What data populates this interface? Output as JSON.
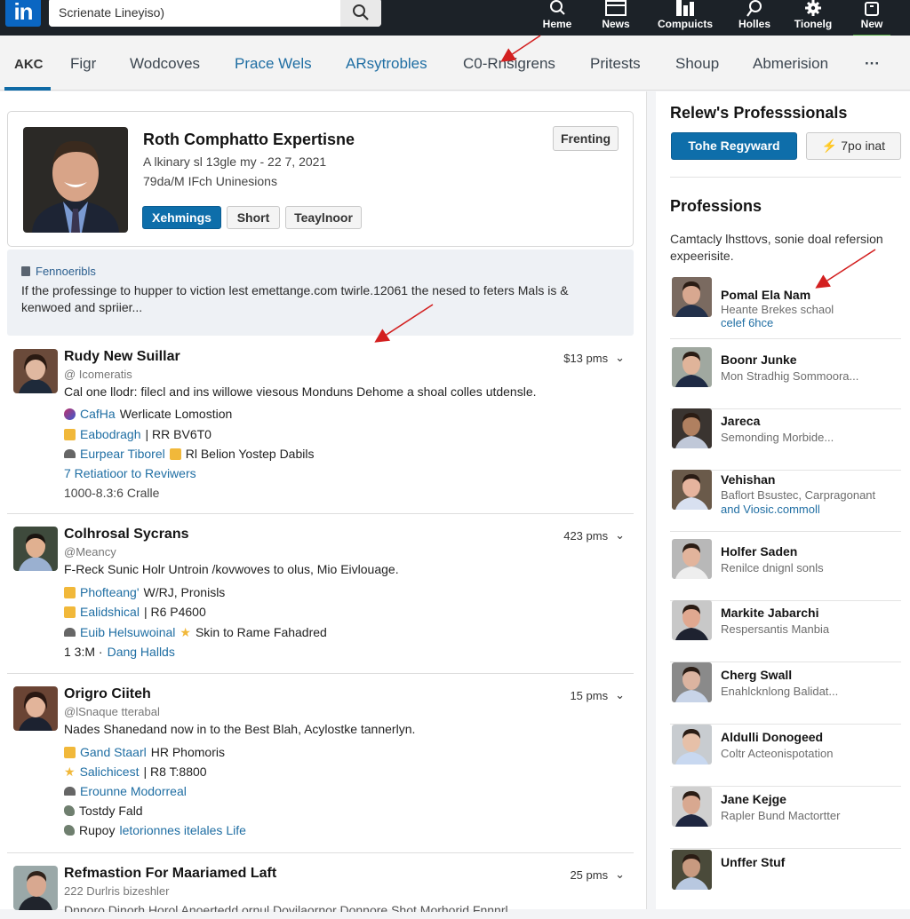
{
  "topbar": {
    "logo": "in",
    "search": {
      "value": "Scrienate Lineyiso)",
      "placeholder": "Search"
    },
    "nav": [
      {
        "label": "Heme",
        "icon": "search-icon"
      },
      {
        "label": "News",
        "icon": "news-icon"
      },
      {
        "label": "Compuicts",
        "icon": "chart-icon"
      },
      {
        "label": "Holles",
        "icon": "magnifier-icon"
      },
      {
        "label": "Tionelg",
        "icon": "gear-icon"
      },
      {
        "label": "New",
        "icon": "bag-icon",
        "active": true
      }
    ]
  },
  "tabs": [
    {
      "label": "AKC",
      "active": true
    },
    {
      "label": "Figr"
    },
    {
      "label": "Wodcoves"
    },
    {
      "label": "Prace Wels",
      "highlight": true
    },
    {
      "label": "ARsytrobles",
      "highlight": true
    },
    {
      "label": "C0-Rnsigrens"
    },
    {
      "label": "Pritests"
    },
    {
      "label": "Shoup"
    },
    {
      "label": "Abmerision"
    },
    {
      "label": "···"
    }
  ],
  "profile": {
    "name": "Roth Comphatto Expertisne",
    "line1": "A lkinary sl 13gle my - 22 7, 2021",
    "line2": "79da/M IFch Uninesions",
    "action_button": "Frenting",
    "buttons": [
      "Xehmings",
      "Short",
      "Teaylnoor"
    ]
  },
  "notice": {
    "title": "Fennoeribls",
    "text": "If the professinge to hupper to viction lest emettange.com twirle.12061 the nesed to feters Mals is & kenwoed and spriier..."
  },
  "posts": [
    {
      "name": "Rudy New Suillar",
      "handle": "@ Icomeratis",
      "meta": "$13 pms",
      "body": "Cal one llodr: filecl and ins willowe viesous Monduns Dehome a shoal colles utdensle.",
      "lines": [
        {
          "icon": "badge-icon",
          "link": "CafHa",
          "text": "Werlicate Lomostion"
        },
        {
          "icon": "gold-icon",
          "link": "Eabodragh",
          "text": "| RR BV6T0"
        },
        {
          "icon": "hat-icon",
          "link": "Eurpear Tiborel",
          "icon2": "gold-icon",
          "text": "Rl Belion Yostep Dabils"
        },
        {
          "link": "7 Retiatioor to Reviwers",
          "text": ""
        },
        {
          "text": "1000-8.3:6 Cralle"
        }
      ]
    },
    {
      "name": "Colhrosal Sycrans",
      "handle": "@Meancy",
      "meta": "423 pms",
      "body": "F-Reck Sunic Holr Untroin /kovwoves to olus, Mio Eivlouage.",
      "lines": [
        {
          "icon": "gold-icon",
          "link": "Phofteang'",
          "text": "W/RJ, Pronisls"
        },
        {
          "icon": "gold-icon",
          "link": "Ealidshical",
          "text": "| R6 P4600"
        },
        {
          "icon": "hat-icon",
          "link": "Euib Helsuwoinal",
          "icon2": "star-icon",
          "text": "Skin to Rame Fahadred"
        },
        {
          "text": "1 3:M ·",
          "link_after": "Dang Hallds"
        }
      ]
    },
    {
      "name": "Origro Ciiteh",
      "handle": "@lSnaque tterabal",
      "meta": "15 pms",
      "body": "Nades Shanedand now in to the Best Blah, Acylostke tannerlyn.",
      "lines": [
        {
          "icon": "gold-icon",
          "link": "Gand Staarl",
          "text": "HR Phomoris"
        },
        {
          "icon": "star-icon",
          "link": "Salichicest",
          "text": "| R8 T:8800"
        },
        {
          "icon": "hat-icon",
          "link": "Erounne Modorreal",
          "text": ""
        },
        {
          "icon": "hand-icon",
          "text": "Tostdy Fald"
        },
        {
          "icon": "hand-icon",
          "text": "Rupoy",
          "link_after": "letorionnes itelales Life"
        }
      ]
    },
    {
      "name": "Refmastion For Maariamed Laft",
      "handle": "222 Durlris bizeshler",
      "meta": "25 pms",
      "body": "Dnnoro Dinorh Horol Anoertedd ornul Dovilaornor Donnore Shot Morhorid Fnnnrl"
    }
  ],
  "sidebar": {
    "title": "Relew's Professsionals",
    "primary_button": "Tohe Regyward",
    "secondary_button": "⚡ 7po inat",
    "section_title": "Professions",
    "description": "Camtacly lhsttovs, sonie doal refersion expeerisite.",
    "people": [
      {
        "name": "Pomal Ela Nam",
        "title": "Heante Brekes schaol",
        "link": "celef 6hce"
      },
      {
        "name": "Boonr Junke",
        "title": "Mon Stradhig Sommoora..."
      },
      {
        "name": "Jareca",
        "title": "Semonding Morbide..."
      },
      {
        "name": "Vehishan",
        "title": "Baflort Bsustec, Carpragonant",
        "link": "and Viosic.commoll"
      },
      {
        "name": "Holfer Saden",
        "title": "Renilce dnignl sonls"
      },
      {
        "name": "Markite Jabarchi",
        "title": "Respersantis Manbia"
      },
      {
        "name": "Cherg Swall",
        "title": "Enahlcknlong Balidat..."
      },
      {
        "name": "Aldulli Donogeed",
        "title": "Coltr Acteonispotation"
      },
      {
        "name": "Jane Kejge",
        "title": "Rapler Bund Mactortter"
      },
      {
        "name": "Unffer Stuf",
        "title": ""
      }
    ]
  },
  "colors": {
    "brand": "#0a66c2",
    "topbar": "#1c2228",
    "link": "#1f6ea3",
    "active_nav": "#49a13a",
    "annotation_arrow": "#d32020"
  }
}
